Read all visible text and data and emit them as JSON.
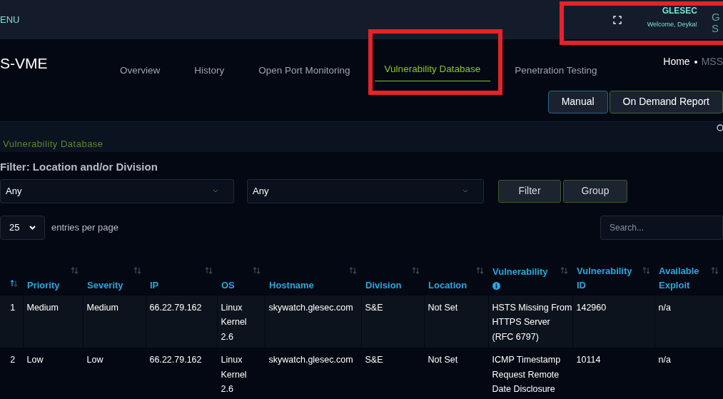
{
  "topbar": {
    "menu_label": "ENU",
    "brand": "GLESEC",
    "welcome": "Welcome, Deyka!",
    "logo_letters": [
      "G",
      "S"
    ]
  },
  "navbar": {
    "app_title": "S-VME",
    "tabs": [
      {
        "label": "Overview",
        "selected": false
      },
      {
        "label": "History",
        "selected": false
      },
      {
        "label": "Open Port Monitoring",
        "selected": false
      },
      {
        "label": "Vulnerability Database",
        "selected": true
      },
      {
        "label": "Penetration Testing",
        "selected": false
      }
    ],
    "breadcrumb": [
      "Home",
      "MSS"
    ]
  },
  "actions": [
    {
      "label": "Manual",
      "color": "#1e6a8a"
    },
    {
      "label": "On Demand Report",
      "color": "#3f6b2a"
    }
  ],
  "card": {
    "title": "Vulnerability Database",
    "filter_label": "Filter: Location and/or Division",
    "selects": [
      "Any",
      "Any"
    ],
    "filter_buttons": [
      "Filter",
      "Group"
    ],
    "page_size": "25",
    "entries_label": "entries per page",
    "search_placeholder": "Search...",
    "table": {
      "columns": [
        {
          "sorted": true,
          "info": false
        },
        {
          "label": "Priority",
          "sorted": false,
          "info": false
        },
        {
          "label": "Severity",
          "sorted": false,
          "info": false
        },
        {
          "label": "IP",
          "sorted": false,
          "info": false
        },
        {
          "label": "OS",
          "sorted": false,
          "info": false
        },
        {
          "label": "Hostname",
          "sorted": false,
          "info": false
        },
        {
          "label": "Division",
          "sorted": false,
          "info": false
        },
        {
          "label": "Location",
          "sorted": false,
          "info": false
        },
        {
          "label": "Vulnerability",
          "sorted": false,
          "info": true
        },
        {
          "label": "Vulnerability ID",
          "sorted": false,
          "info": false
        },
        {
          "label": "Available Exploit",
          "sorted": false,
          "info": false
        }
      ],
      "rows": [
        [
          "1",
          "Medium",
          "Medium",
          "66.22.79.162",
          "Linux Kernel 2.6",
          "skywatch.glesec.com",
          "S&E",
          "Not Set",
          "HSTS Missing From HTTPS Server (RFC 6797)",
          "142960",
          "n/a"
        ],
        [
          "2",
          "Low",
          "Low",
          "66.22.79.162",
          "Linux Kernel 2.6",
          "skywatch.glesec.com",
          "S&E",
          "Not Set",
          "ICMP Timestamp Request Remote Date Disclosure",
          "10114",
          "n/a"
        ]
      ]
    }
  }
}
